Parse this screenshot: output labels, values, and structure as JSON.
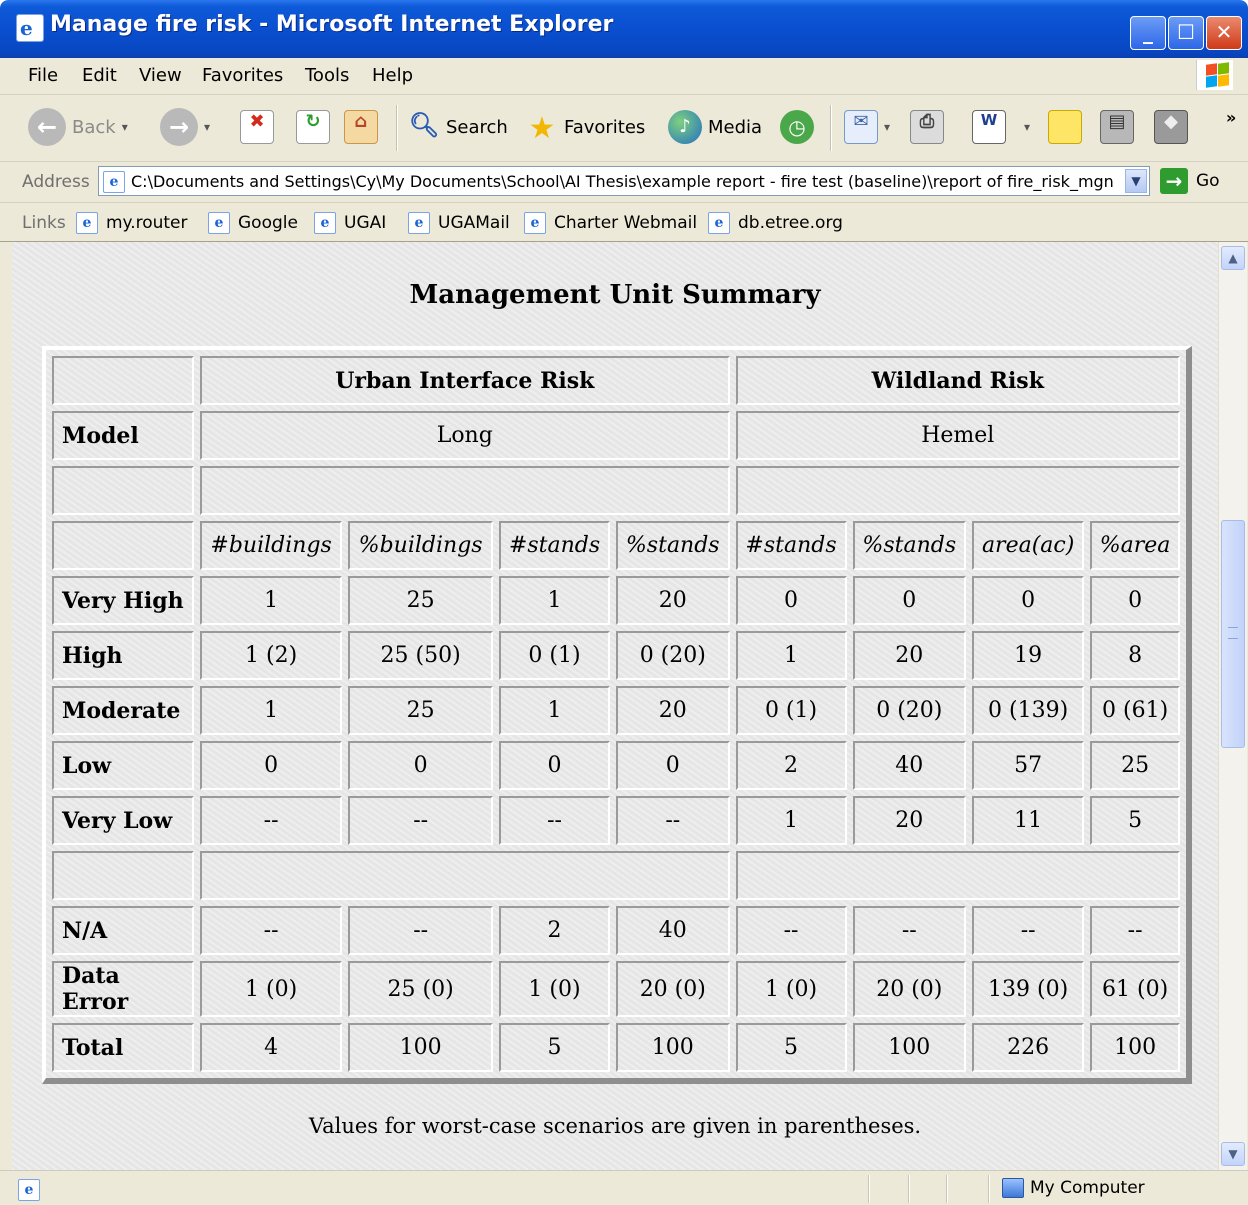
{
  "window": {
    "title": "Manage fire risk - Microsoft Internet Explorer"
  },
  "menu": [
    "File",
    "Edit",
    "View",
    "Favorites",
    "Tools",
    "Help"
  ],
  "toolbar": {
    "back_label": "Back",
    "search_label": "Search",
    "favorites_label": "Favorites",
    "media_label": "Media"
  },
  "address": {
    "label": "Address",
    "value": "C:\\Documents and Settings\\Cy\\My Documents\\School\\AI Thesis\\example report - fire test (baseline)\\report of fire_risk_mgn",
    "go_label": "Go"
  },
  "links": {
    "label": "Links",
    "items": [
      "my.router",
      "Google",
      "UGAI",
      "UGAMail",
      "Charter Webmail",
      "db.etree.org"
    ]
  },
  "content": {
    "title": "Management Unit Summary",
    "groups": [
      "Urban Interface Risk",
      "Wildland Risk"
    ],
    "model_label": "Model",
    "models": [
      "Long",
      "Hemel"
    ],
    "subheaders": [
      "#buildings",
      "%buildings",
      "#stands",
      "%stands",
      "#stands",
      "%stands",
      "area(ac)",
      "%area"
    ],
    "rows": [
      {
        "label": "Very High",
        "values": [
          "1",
          "25",
          "1",
          "20",
          "0",
          "0",
          "0",
          "0"
        ]
      },
      {
        "label": "High",
        "values": [
          "1 (2)",
          "25 (50)",
          "0 (1)",
          "0 (20)",
          "1",
          "20",
          "19",
          "8"
        ]
      },
      {
        "label": "Moderate",
        "values": [
          "1",
          "25",
          "1",
          "20",
          "0 (1)",
          "0 (20)",
          "0 (139)",
          "0 (61)"
        ]
      },
      {
        "label": "Low",
        "values": [
          "0",
          "0",
          "0",
          "0",
          "2",
          "40",
          "57",
          "25"
        ]
      },
      {
        "label": "Very Low",
        "values": [
          "--",
          "--",
          "--",
          "--",
          "1",
          "20",
          "11",
          "5"
        ]
      },
      {
        "label": "N/A",
        "values": [
          "--",
          "--",
          "2",
          "40",
          "--",
          "--",
          "--",
          "--"
        ]
      },
      {
        "label": "Data Error",
        "values": [
          "1 (0)",
          "25 (0)",
          "1 (0)",
          "20 (0)",
          "1 (0)",
          "20 (0)",
          "139 (0)",
          "61 (0)"
        ]
      },
      {
        "label": "Total",
        "values": [
          "4",
          "100",
          "5",
          "100",
          "5",
          "100",
          "226",
          "100"
        ]
      }
    ],
    "footnote": "Values for worst-case scenarios are given in parentheses."
  },
  "status": {
    "zone": "My Computer"
  }
}
